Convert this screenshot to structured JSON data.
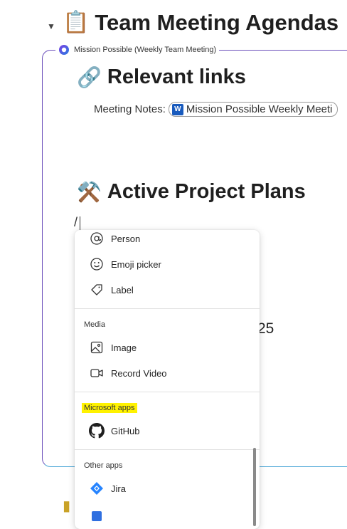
{
  "header": {
    "title": "Team Meeting Agendas",
    "title_emoji": "📋"
  },
  "loop": {
    "label": "Mission Possible (Weekly Team Meeting)"
  },
  "links_section": {
    "emoji": "🔗",
    "heading": "Relevant links",
    "meeting_notes_label": "Meeting Notes:",
    "doc_chip_text": "Mission Possible Weekly Meeti",
    "doc_icon_letter": "W"
  },
  "plans_section": {
    "emoji": "⚒️",
    "heading": "Active Project Plans",
    "typed_text": "/",
    "partial_text_behind_menu": "25"
  },
  "menu": {
    "items_top": [
      {
        "icon": "at-icon",
        "glyph": "@",
        "label": "Person"
      },
      {
        "icon": "emoji-icon",
        "glyph": "☺",
        "label": "Emoji picker"
      },
      {
        "icon": "tag-icon",
        "glyph": "◇",
        "label": "Label"
      }
    ],
    "media": {
      "title": "Media",
      "items": [
        {
          "icon": "image-icon",
          "label": "Image"
        },
        {
          "icon": "video-icon",
          "label": "Record Video"
        }
      ]
    },
    "microsoft_apps": {
      "title": "Microsoft apps",
      "highlight_color": "#fff200",
      "items": [
        {
          "icon": "github-icon",
          "label": "GitHub"
        }
      ]
    },
    "other_apps": {
      "title": "Other apps",
      "items": [
        {
          "icon": "jira-icon",
          "label": "Jira"
        }
      ]
    }
  },
  "colors": {
    "loop_border": "#6b4fbb",
    "word_blue": "#185abd",
    "jira_blue": "#2684ff"
  }
}
